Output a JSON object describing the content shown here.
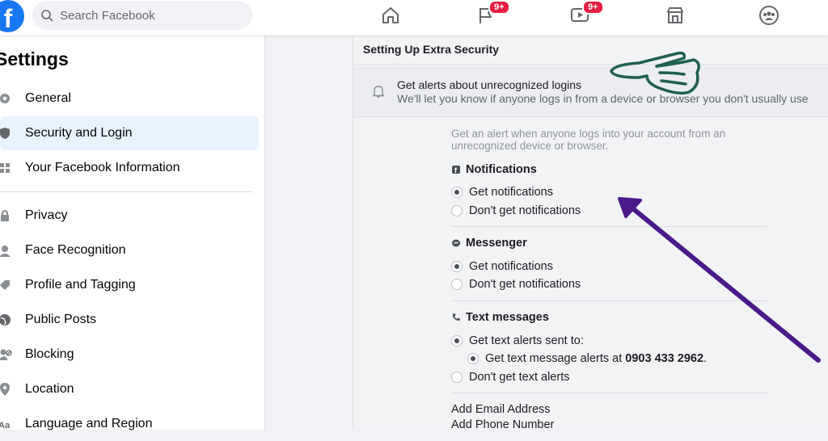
{
  "topbar": {
    "logo_letter": "f",
    "search_placeholder": "Search Facebook",
    "nav": [
      {
        "icon": "home-icon",
        "badge": ""
      },
      {
        "icon": "flag-icon",
        "badge": "9+"
      },
      {
        "icon": "watch-icon",
        "badge": "9+"
      },
      {
        "icon": "marketplace-icon",
        "badge": ""
      },
      {
        "icon": "groups-icon",
        "badge": ""
      }
    ]
  },
  "sidebar": {
    "title": "Settings",
    "items": [
      {
        "label": "General",
        "icon": "gear-icon"
      },
      {
        "label": "Security and Login",
        "icon": "shield-icon"
      },
      {
        "label": "Your Facebook Information",
        "icon": "grid-icon"
      },
      {
        "label": "Privacy",
        "icon": "lock-icon"
      },
      {
        "label": "Face Recognition",
        "icon": "face-icon"
      },
      {
        "label": "Profile and Tagging",
        "icon": "tag-icon"
      },
      {
        "label": "Public Posts",
        "icon": "globe-icon"
      },
      {
        "label": "Blocking",
        "icon": "block-icon"
      },
      {
        "label": "Location",
        "icon": "location-icon"
      },
      {
        "label": "Language and Region",
        "icon": "language-icon"
      }
    ]
  },
  "panel": {
    "heading": "Setting Up Extra Security",
    "alert_title": "Get alerts about unrecognized logins",
    "alert_sub": "We'll let you know if anyone logs in from a device or browser you don't usually use",
    "intro": "Get an alert when anyone logs into your account from an unrecognized device or browser.",
    "notifications": {
      "title": "Notifications",
      "opt_on": "Get notifications",
      "opt_off": "Don't get notifications"
    },
    "messenger": {
      "title": "Messenger",
      "opt_on": "Get notifications",
      "opt_off": "Don't get notifications"
    },
    "text": {
      "title": "Text messages",
      "opt_sent": "Get text alerts sent to:",
      "opt_phone_prefix": "Get text message alerts at ",
      "phone": "0903 433 2962",
      "phone_suffix": ".",
      "opt_off": "Don't get text alerts"
    },
    "add_email": "Add Email Address",
    "add_phone": "Add Phone Number"
  },
  "colors": {
    "brand": "#1877f2",
    "badge": "#e41e3f",
    "pointer_annotation": "#1f5f52",
    "arrow_annotation": "#4b1a8a"
  }
}
